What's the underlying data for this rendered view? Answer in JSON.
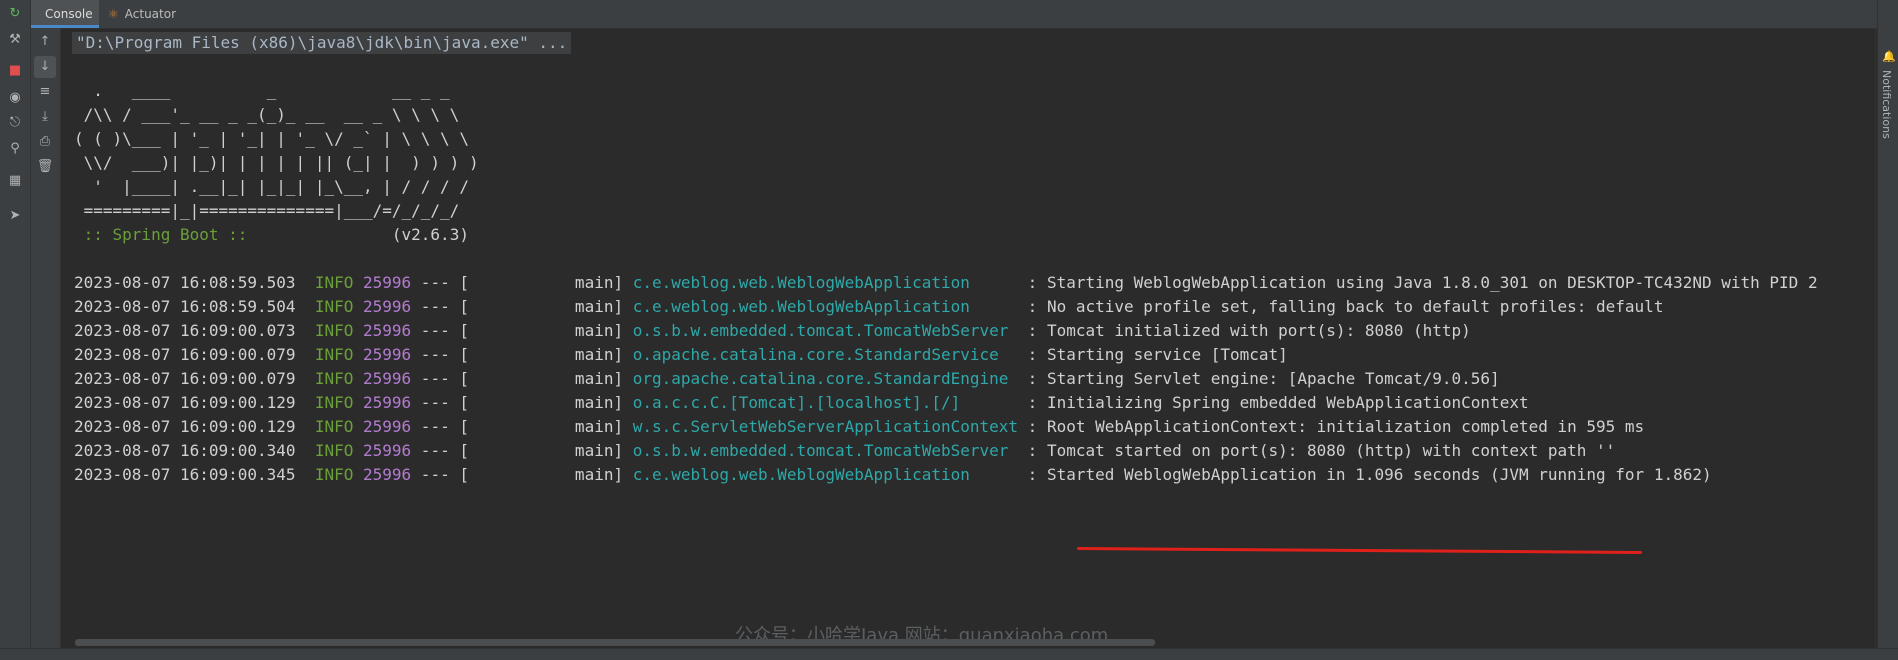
{
  "tabs": [
    {
      "label": "Console",
      "icon": "none"
    },
    {
      "label": "Actuator",
      "icon": "actuator-icon"
    }
  ],
  "right_panel": {
    "notifications_label": "Notifications"
  },
  "console": {
    "command": "\"D:\\Program Files (x86)\\java8\\jdk\\bin\\java.exe\" ...",
    "banner": [
      "  .   ____          _            __ _ _",
      " /\\\\ / ___'_ __ _ _(_)_ __  __ _ \\ \\ \\ \\",
      "( ( )\\___ | '_ | '_| | '_ \\/ _` | \\ \\ \\ \\",
      " \\\\/  ___)| |_)| | | | | || (_| |  ) ) ) )",
      "  '  |____| .__|_| |_|_| |_\\__, | / / / /",
      " =========|_|==============|___/=/_/_/_/"
    ],
    "spring_boot_label": " :: Spring Boot :: ",
    "spring_boot_version": "              (v2.6.3)",
    "logs": [
      {
        "timestamp": "2023-08-07 16:08:59.503",
        "level": "INFO",
        "pid": "25996",
        "thread": " --- [           main]",
        "logger": "c.e.weblog.web.WeblogWebApplication     ",
        "message": " : Starting WeblogWebApplication using Java 1.8.0_301 on DESKTOP-TC432ND with PID 2"
      },
      {
        "timestamp": "2023-08-07 16:08:59.504",
        "level": "INFO",
        "pid": "25996",
        "thread": " --- [           main]",
        "logger": "c.e.weblog.web.WeblogWebApplication     ",
        "message": " : No active profile set, falling back to default profiles: default"
      },
      {
        "timestamp": "2023-08-07 16:09:00.073",
        "level": "INFO",
        "pid": "25996",
        "thread": " --- [           main]",
        "logger": "o.s.b.w.embedded.tomcat.TomcatWebServer ",
        "message": " : Tomcat initialized with port(s): 8080 (http)"
      },
      {
        "timestamp": "2023-08-07 16:09:00.079",
        "level": "INFO",
        "pid": "25996",
        "thread": " --- [           main]",
        "logger": "o.apache.catalina.core.StandardService  ",
        "message": " : Starting service [Tomcat]"
      },
      {
        "timestamp": "2023-08-07 16:09:00.079",
        "level": "INFO",
        "pid": "25996",
        "thread": " --- [           main]",
        "logger": "org.apache.catalina.core.StandardEngine ",
        "message": " : Starting Servlet engine: [Apache Tomcat/9.0.56]"
      },
      {
        "timestamp": "2023-08-07 16:09:00.129",
        "level": "INFO",
        "pid": "25996",
        "thread": " --- [           main]",
        "logger": "o.a.c.c.C.[Tomcat].[localhost].[/]      ",
        "message": " : Initializing Spring embedded WebApplicationContext"
      },
      {
        "timestamp": "2023-08-07 16:09:00.129",
        "level": "INFO",
        "pid": "25996",
        "thread": " --- [           main]",
        "logger": "w.s.c.ServletWebServerApplicationContext",
        "message": " : Root WebApplicationContext: initialization completed in 595 ms"
      },
      {
        "timestamp": "2023-08-07 16:09:00.340",
        "level": "INFO",
        "pid": "25996",
        "thread": " --- [           main]",
        "logger": "o.s.b.w.embedded.tomcat.TomcatWebServer ",
        "message": " : Tomcat started on port(s): 8080 (http) with context path ''"
      },
      {
        "timestamp": "2023-08-07 16:09:00.345",
        "level": "INFO",
        "pid": "25996",
        "thread": " --- [           main]",
        "logger": "c.e.weblog.web.WeblogWebApplication     ",
        "message": " : Started WeblogWebApplication in 1.096 seconds (JVM running for 1.862)"
      }
    ]
  },
  "watermark": "公众号：小哈学Java 网站：quanxiaoha.com",
  "colors": {
    "background": "#2b2b2b",
    "info": "#6a9f3a",
    "pid": "#b37bd0",
    "logger": "#2ea8a8",
    "underline": "#e0201a"
  }
}
